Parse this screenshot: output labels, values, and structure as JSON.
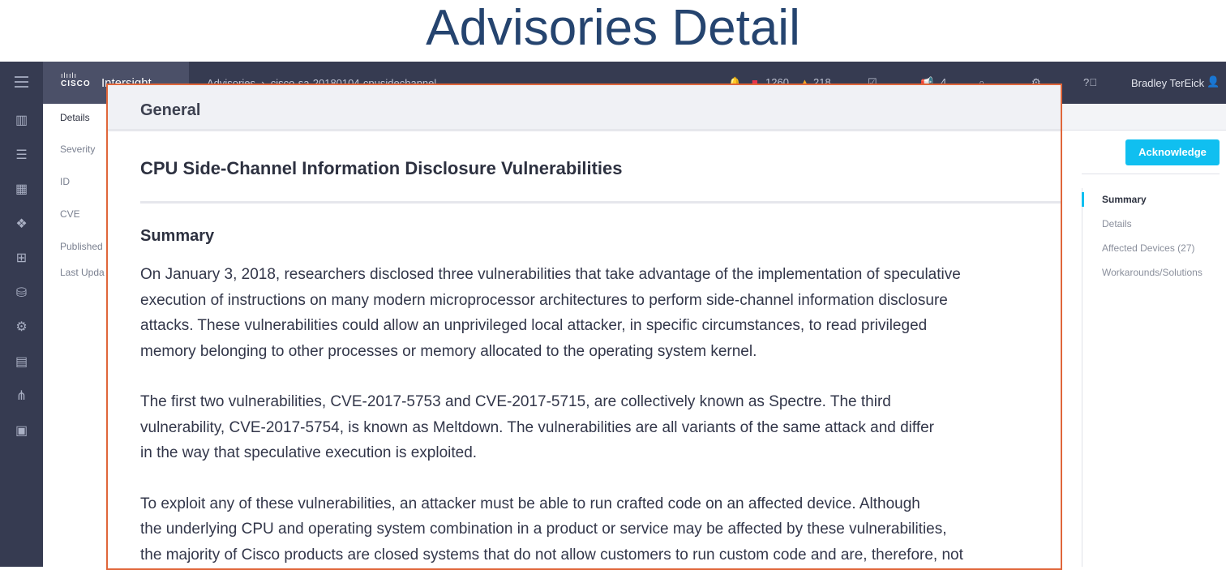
{
  "page_title": "Advisories Detail",
  "topbar": {
    "brand": "CISCO",
    "product": "Intersight",
    "breadcrumb": [
      "Advisories",
      "cisco-sa-20180104-cpusidechannel"
    ],
    "critical_count": "1260",
    "warning_count": "218",
    "announcements_count": "4",
    "user": "Bradley TerEick"
  },
  "side": {
    "tab": "Details",
    "fields": [
      "Severity",
      "ID",
      "CVE",
      "Published",
      "Last Upda"
    ]
  },
  "acknowledge": "Acknowledge",
  "right_nav": [
    "Summary",
    "Details",
    "Affected Devices (27)",
    "Workarounds/Solutions"
  ],
  "panel": {
    "header": "General",
    "title": "CPU Side-Channel Information Disclosure Vulnerabilities",
    "summary_heading": "Summary",
    "paragraphs": [
      "On January 3, 2018, researchers disclosed three vulnerabilities that take advantage of the implementation of speculative\nexecution of instructions on many modern microprocessor architectures to perform side-channel information disclosure\nattacks. These vulnerabilities could allow an unprivileged local attacker, in specific circumstances, to read privileged\nmemory belonging to other processes or memory allocated to the operating system kernel.",
      "The first two vulnerabilities, CVE-2017-5753 and CVE-2017-5715, are collectively known as Spectre. The third\nvulnerability, CVE-2017-5754, is known as Meltdown. The vulnerabilities are all variants of the same attack and differ\nin the way that speculative execution is exploited.",
      "To exploit any of these vulnerabilities, an attacker must be able to run crafted code on an affected device. Although\nthe underlying CPU and operating system combination in a product or service may be affected by these vulnerabilities,\nthe majority of Cisco products are closed systems that do not allow customers to run custom code and are, therefore, not"
    ]
  },
  "colors": {
    "accent": "#10bff0",
    "highlight_border": "#e0663a",
    "nav_bg": "#363b51"
  }
}
